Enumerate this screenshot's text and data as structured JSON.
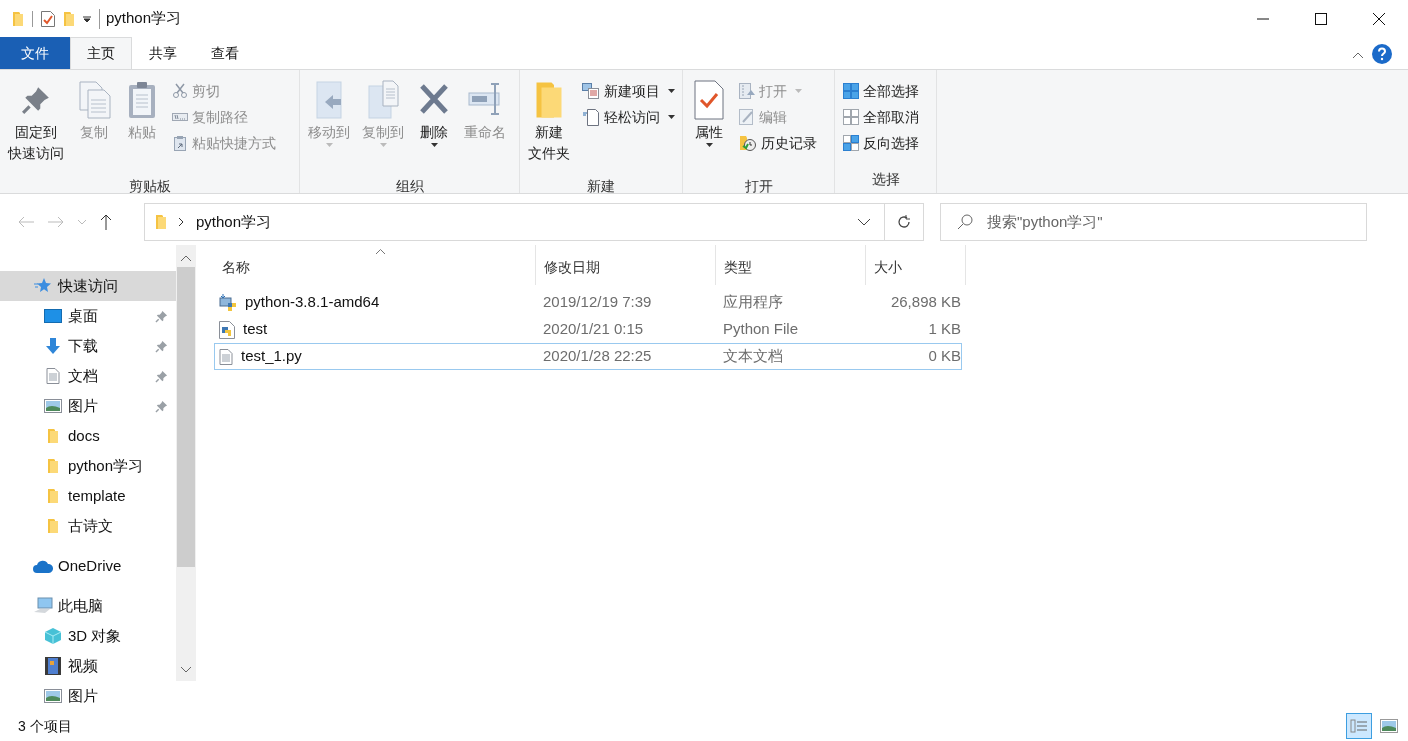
{
  "window": {
    "title": "python学习"
  },
  "ribbon_tabs": [
    {
      "label": "文件",
      "kind": "file",
      "selected": false
    },
    {
      "label": "主页",
      "kind": "tab",
      "selected": true
    },
    {
      "label": "共享",
      "kind": "tab",
      "selected": false
    },
    {
      "label": "查看",
      "kind": "tab",
      "selected": false
    }
  ],
  "ribbon_groups": [
    {
      "label": "剪贴板",
      "items": [
        {
          "kind": "large",
          "lines": [
            "固定到",
            "快速访问"
          ],
          "disabled": false,
          "dropdown": false
        },
        {
          "kind": "large",
          "lines": [
            "复制"
          ],
          "disabled": true,
          "dropdown": false
        },
        {
          "kind": "large",
          "lines": [
            "粘贴"
          ],
          "disabled": true,
          "dropdown": false
        },
        {
          "kind": "small",
          "label": "剪切",
          "disabled": true,
          "dropdown": false
        },
        {
          "kind": "small",
          "label": "复制路径",
          "disabled": true,
          "dropdown": false
        },
        {
          "kind": "small",
          "label": "粘贴快捷方式",
          "disabled": true,
          "dropdown": false
        }
      ]
    },
    {
      "label": "组织",
      "items": [
        {
          "kind": "large",
          "lines": [
            "移动到"
          ],
          "disabled": true,
          "dropdown": true
        },
        {
          "kind": "large",
          "lines": [
            "复制到"
          ],
          "disabled": true,
          "dropdown": true
        },
        {
          "kind": "large",
          "lines": [
            "删除"
          ],
          "disabled": false,
          "dropdown": true
        },
        {
          "kind": "large",
          "lines": [
            "重命名"
          ],
          "disabled": true,
          "dropdown": false
        }
      ]
    },
    {
      "label": "新建",
      "items": [
        {
          "kind": "large",
          "lines": [
            "新建",
            "文件夹"
          ],
          "disabled": false,
          "dropdown": false
        },
        {
          "kind": "small",
          "label": "新建项目",
          "disabled": false,
          "dropdown": true
        },
        {
          "kind": "small",
          "label": "轻松访问",
          "disabled": false,
          "dropdown": true
        }
      ]
    },
    {
      "label": "打开",
      "items": [
        {
          "kind": "large",
          "lines": [
            "属性"
          ],
          "disabled": false,
          "dropdown": true
        },
        {
          "kind": "small",
          "label": "打开",
          "disabled": true,
          "dropdown": true
        },
        {
          "kind": "small",
          "label": "编辑",
          "disabled": true,
          "dropdown": false
        },
        {
          "kind": "small",
          "label": "历史记录",
          "disabled": false,
          "dropdown": false
        }
      ]
    },
    {
      "label": "选择",
      "items": [
        {
          "kind": "small",
          "label": "全部选择",
          "disabled": false,
          "dropdown": false
        },
        {
          "kind": "small",
          "label": "全部取消",
          "disabled": false,
          "dropdown": false
        },
        {
          "kind": "small",
          "label": "反向选择",
          "disabled": false,
          "dropdown": false
        }
      ]
    }
  ],
  "address_bar": {
    "path": "python学习"
  },
  "search": {
    "placeholder": "搜索\"python学习\""
  },
  "navigation": [
    {
      "label": "快速访问",
      "selected": true,
      "pinned": false,
      "children": [
        {
          "label": "桌面",
          "selected": false,
          "pinned": true
        },
        {
          "label": "下载",
          "selected": false,
          "pinned": true
        },
        {
          "label": "文档",
          "selected": false,
          "pinned": true
        },
        {
          "label": "图片",
          "selected": false,
          "pinned": true
        },
        {
          "label": "docs",
          "selected": false,
          "pinned": false
        },
        {
          "label": "python学习",
          "selected": false,
          "pinned": false
        },
        {
          "label": "template",
          "selected": false,
          "pinned": false
        },
        {
          "label": "古诗文",
          "selected": false,
          "pinned": false
        }
      ]
    },
    {
      "label": "OneDrive",
      "selected": false,
      "pinned": false
    },
    {
      "label": "此电脑",
      "selected": false,
      "pinned": false,
      "children": [
        {
          "label": "3D 对象",
          "selected": false,
          "pinned": false
        },
        {
          "label": "视频",
          "selected": false,
          "pinned": false
        },
        {
          "label": "图片",
          "selected": false,
          "pinned": false
        }
      ]
    }
  ],
  "file_list": {
    "columns": [
      {
        "label": "名称",
        "sorted": true
      },
      {
        "label": "修改日期",
        "sorted": false
      },
      {
        "label": "类型",
        "sorted": false
      },
      {
        "label": "大小",
        "sorted": false
      }
    ],
    "rows": [
      {
        "name": "python-3.8.1-amd64",
        "modified": "2019/12/19 7:39",
        "type": "应用程序",
        "size": "26,898 KB",
        "focused": false
      },
      {
        "name": "test",
        "modified": "2020/1/21 0:15",
        "type": "Python File",
        "size": "1 KB",
        "focused": false
      },
      {
        "name": "test_1.py",
        "modified": "2020/1/28 22:25",
        "type": "文本文档",
        "size": "0 KB",
        "focused": true
      }
    ]
  },
  "status_bar": {
    "item_count": "3 个项目",
    "views": [
      {
        "kind": "details",
        "selected": true
      },
      {
        "kind": "thumbnails",
        "selected": false
      }
    ]
  }
}
